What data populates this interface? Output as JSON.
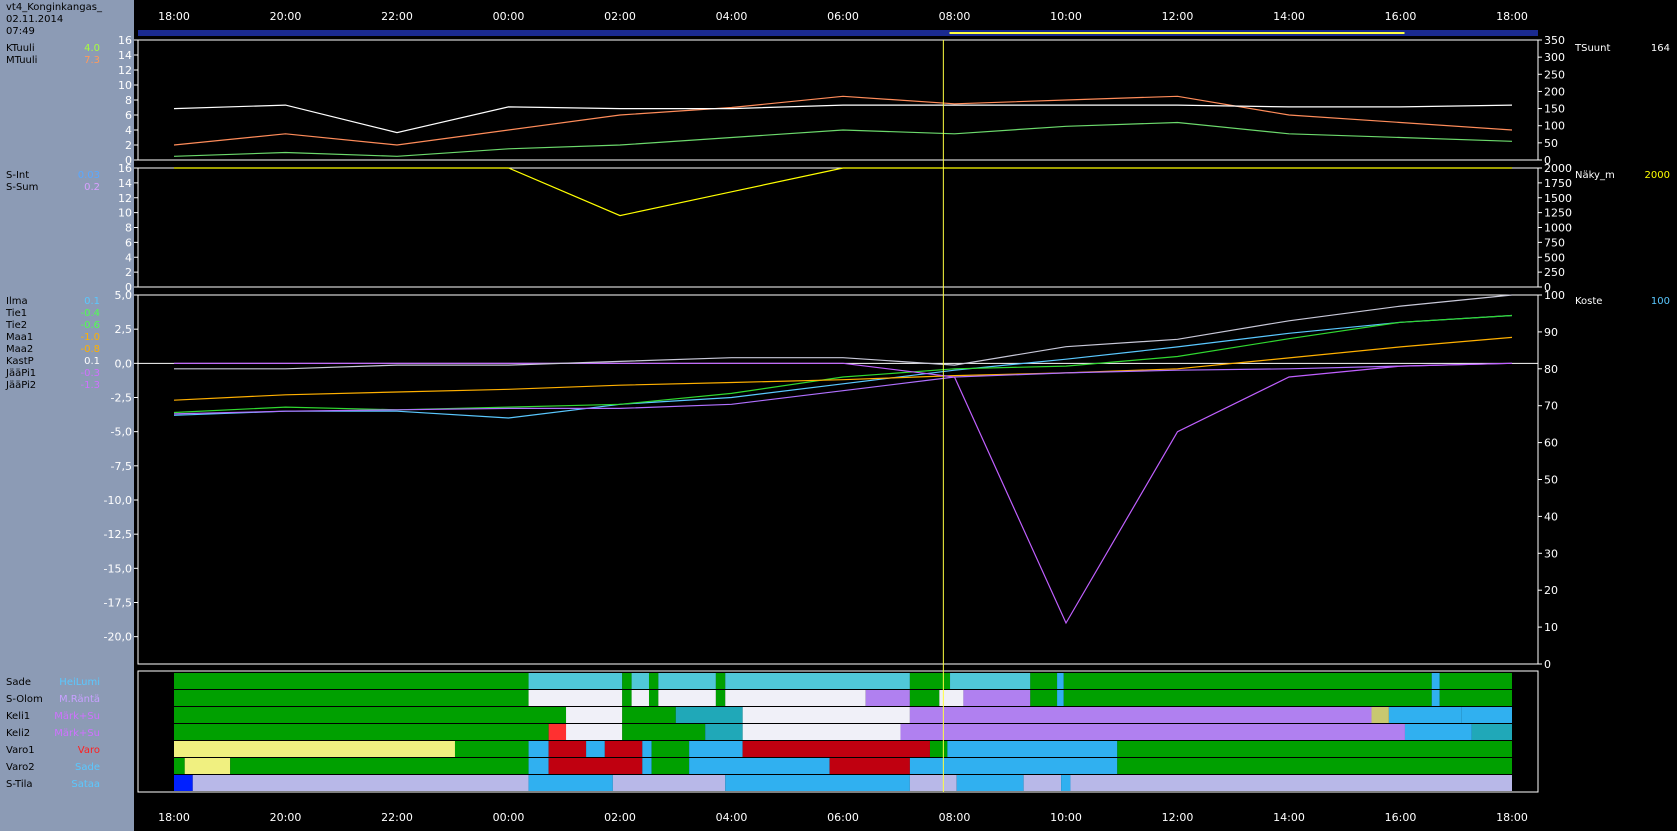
{
  "station": {
    "name": "vt4_Konginkangas_",
    "date": "02.11.2014",
    "time": "07:49"
  },
  "time_axis": [
    "18:00",
    "20:00",
    "22:00",
    "00:00",
    "02:00",
    "04:00",
    "06:00",
    "08:00",
    "10:00",
    "12:00",
    "14:00",
    "16:00",
    "18:00"
  ],
  "panel1": {
    "left_labels": [
      {
        "name": "KTuuli",
        "value": "4.0",
        "color": "#a8ff3c"
      },
      {
        "name": "MTuuli",
        "value": "7.3",
        "color": "#ff9a5c"
      }
    ],
    "right_labels": [
      {
        "name": "TSuunt",
        "value": "164",
        "color": "#ffffff"
      }
    ],
    "left_ticks": [
      "16",
      "14",
      "12",
      "10",
      "8",
      "6",
      "4",
      "2",
      "0"
    ],
    "right_ticks": [
      "350",
      "300",
      "250",
      "200",
      "150",
      "100",
      "50",
      "0"
    ]
  },
  "panel2": {
    "left_labels": [
      {
        "name": "S-Int",
        "value": "0.03",
        "color": "#5aa8ff"
      },
      {
        "name": "S-Sum",
        "value": "0.2",
        "color": "#d8a0ff"
      }
    ],
    "right_labels": [
      {
        "name": "Näky_m",
        "value": "2000",
        "color": "#ffff00"
      }
    ],
    "left_ticks": [
      "16",
      "14",
      "12",
      "10",
      "8",
      "6",
      "4",
      "2",
      "0"
    ],
    "right_ticks": [
      "2000",
      "1750",
      "1500",
      "1250",
      "1000",
      "750",
      "500",
      "250",
      "0"
    ]
  },
  "panel3": {
    "left_labels": [
      {
        "name": "Ilma",
        "value": "0.1",
        "color": "#5ac8ff"
      },
      {
        "name": "Tie1",
        "value": "-0.4",
        "color": "#50ff50"
      },
      {
        "name": "Tie2",
        "value": "-0.6",
        "color": "#50ff50"
      },
      {
        "name": "Maa1",
        "value": "-1.0",
        "color": "#ffb000"
      },
      {
        "name": "Maa2",
        "value": "-0.8",
        "color": "#ffb000"
      },
      {
        "name": "KastP",
        "value": "0.1",
        "color": "#ffffff"
      },
      {
        "name": "JääPi1",
        "value": "-0.3",
        "color": "#d070ff"
      },
      {
        "name": "JääPi2",
        "value": "-1.3",
        "color": "#d070ff"
      }
    ],
    "right_labels": [
      {
        "name": "Koste",
        "value": "100",
        "color": "#5ac8ff"
      }
    ],
    "left_ticks": [
      "5,0",
      "2,5",
      "0,0",
      "-2,5",
      "-5,0",
      "-7,5",
      "-10,0",
      "-12,5",
      "-15,0",
      "-17,5",
      "-20,0"
    ],
    "right_ticks": [
      "100",
      "90",
      "80",
      "70",
      "60",
      "50",
      "40",
      "30",
      "20",
      "10",
      "0"
    ]
  },
  "status": {
    "rows": [
      {
        "name": "Sade",
        "value": "HeiLumi",
        "color": "#5ac8ff"
      },
      {
        "name": "S-Olom",
        "value": "M.Räntä",
        "color": "#c8a0ff"
      },
      {
        "name": "Keli1",
        "value": "Märk+Su",
        "color": "#d070ff"
      },
      {
        "name": "Keli2",
        "value": "Märk+Su",
        "color": "#d070ff"
      },
      {
        "name": "Varo1",
        "value": "Varo",
        "color": "#ff2020"
      },
      {
        "name": "Varo2",
        "value": "Sade",
        "color": "#5ac8ff"
      },
      {
        "name": "S-Tila",
        "value": "Sataa",
        "color": "#5ac8ff"
      }
    ]
  },
  "chart_data": {
    "type": "line",
    "x": [
      "18:00",
      "20:00",
      "22:00",
      "00:00",
      "02:00",
      "04:00",
      "06:00",
      "08:00",
      "10:00",
      "12:00",
      "14:00",
      "16:00",
      "18:00"
    ],
    "series": [
      {
        "name": "KTuuli",
        "values": [
          0.5,
          1.0,
          0.5,
          1.5,
          2.0,
          3.0,
          4.0,
          3.5,
          4.5,
          5.0,
          3.5,
          3.0,
          2.5
        ]
      },
      {
        "name": "MTuuli",
        "values": [
          2.0,
          3.5,
          2.0,
          4.0,
          6.0,
          7.0,
          8.5,
          7.5,
          8.0,
          8.5,
          6.0,
          5.0,
          4.0
        ]
      },
      {
        "name": "TSuunt",
        "values": [
          150,
          160,
          80,
          155,
          150,
          150,
          160,
          160,
          160,
          160,
          155,
          155,
          160
        ]
      },
      {
        "name": "Näky_m",
        "values": [
          2000,
          2000,
          2000,
          2000,
          1200,
          1600,
          2000,
          2000,
          2000,
          2000,
          2000,
          2000,
          2000
        ]
      },
      {
        "name": "Ilma",
        "values": [
          -3.8,
          -3.5,
          -3.5,
          -4.0,
          -3.0,
          -2.5,
          -1.5,
          -0.5,
          0.3,
          1.2,
          2.2,
          3.0,
          3.5
        ]
      },
      {
        "name": "Tie1",
        "values": [
          -3.6,
          -3.2,
          -3.4,
          -3.2,
          -3.0,
          -2.2,
          -1.0,
          -0.4,
          -0.2,
          0.5,
          1.8,
          3.0,
          3.5
        ]
      },
      {
        "name": "Maa1",
        "values": [
          -2.7,
          -2.3,
          -2.1,
          -1.9,
          -1.6,
          -1.4,
          -1.2,
          -0.9,
          -0.7,
          -0.4,
          0.4,
          1.2,
          1.9
        ]
      },
      {
        "name": "JääPi1",
        "values": [
          -3.7,
          -3.5,
          -3.4,
          -3.3,
          -3.3,
          -3.0,
          -2.0,
          -1.0,
          -0.7,
          -0.5,
          -0.4,
          -0.2,
          0.0
        ]
      },
      {
        "name": "JääPi2",
        "values": [
          0,
          0,
          0,
          0,
          0,
          0,
          0,
          -1.0,
          -19.0,
          -5.0,
          -1.0,
          -0.2,
          0.0
        ]
      },
      {
        "name": "Koste",
        "values": [
          80,
          80,
          81,
          81,
          82,
          83,
          83,
          81,
          86,
          88,
          93,
          97,
          100
        ]
      }
    ]
  },
  "colors": {
    "sidebar": "#8c9bb5",
    "axis": "#ffffff",
    "cursor": "#ffff40",
    "timebar": "#1a2a90",
    "range": "#ffff40"
  }
}
